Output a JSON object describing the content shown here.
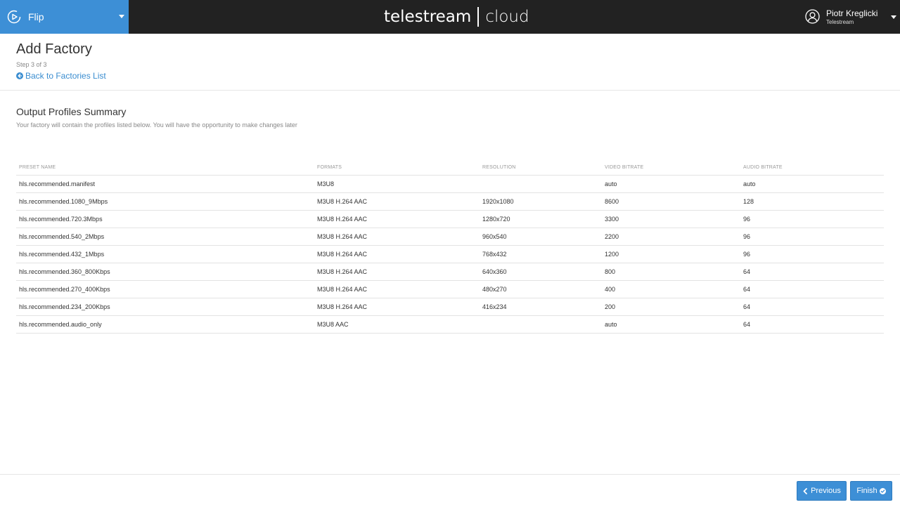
{
  "app": {
    "name": "Flip"
  },
  "brand": {
    "main": "telestream",
    "suffix": "cloud"
  },
  "user": {
    "name": "Piotr Kreglicki",
    "org": "Telestream"
  },
  "page": {
    "title": "Add Factory",
    "step": "Step 3 of 3",
    "back_label": "Back to Factories List"
  },
  "section": {
    "title": "Output Profiles Summary",
    "subtitle": "Your factory will contain the profiles listed below. You will have the opportunity to make changes later"
  },
  "table": {
    "headers": [
      "PRESET NAME",
      "FORMATS",
      "RESOLUTION",
      "VIDEO BITRATE",
      "AUDIO BITRATE"
    ],
    "rows": [
      [
        "hls.recommended.manifest",
        "M3U8",
        "",
        "auto",
        "auto"
      ],
      [
        "hls.recommended.1080_9Mbps",
        "M3U8 H.264 AAC",
        "1920x1080",
        "8600",
        "128"
      ],
      [
        "hls.recommended.720.3Mbps",
        "M3U8 H.264 AAC",
        "1280x720",
        "3300",
        "96"
      ],
      [
        "hls.recommended.540_2Mbps",
        "M3U8 H.264 AAC",
        "960x540",
        "2200",
        "96"
      ],
      [
        "hls.recommended.432_1Mbps",
        "M3U8 H.264 AAC",
        "768x432",
        "1200",
        "96"
      ],
      [
        "hls.recommended.360_800Kbps",
        "M3U8 H.264 AAC",
        "640x360",
        "800",
        "64"
      ],
      [
        "hls.recommended.270_400Kbps",
        "M3U8 H.264 AAC",
        "480x270",
        "400",
        "64"
      ],
      [
        "hls.recommended.234_200Kbps",
        "M3U8 H.264 AAC",
        "416x234",
        "200",
        "64"
      ],
      [
        "hls.recommended.audio_only",
        "M3U8 AAC",
        "",
        "auto",
        "64"
      ]
    ]
  },
  "footer": {
    "previous_label": "Previous",
    "finish_label": "Finish"
  },
  "colors": {
    "accent": "#3d8fd6",
    "topbar": "#222222",
    "link": "#3a8dd0"
  }
}
